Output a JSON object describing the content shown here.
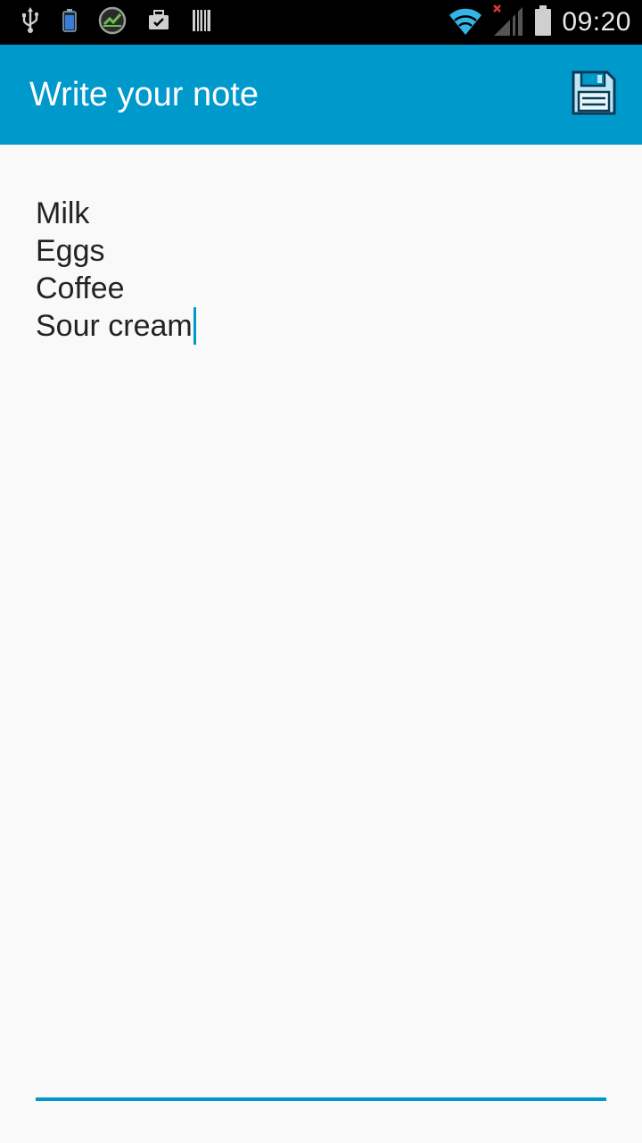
{
  "status_bar": {
    "time": "09:20",
    "left_icons": [
      "usb-icon",
      "battery-app-icon",
      "speedometer-app-icon",
      "briefcase-check-icon",
      "barcode-icon"
    ],
    "right_icons": [
      "wifi-icon",
      "signal-no-service-icon",
      "battery-icon"
    ]
  },
  "app_bar": {
    "title": "Write your note",
    "save_icon": "floppy-disk-icon",
    "background": "#0099cc"
  },
  "note": {
    "lines": [
      "Milk",
      "Eggs",
      "Coffee",
      "Sour cream"
    ]
  },
  "colors": {
    "accent": "#0099cc",
    "page_bg": "#f9f9f9",
    "text": "#222222"
  }
}
